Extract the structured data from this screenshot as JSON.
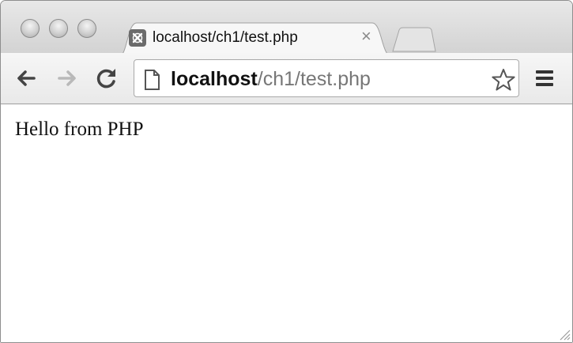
{
  "tab": {
    "title": "localhost/ch1/test.php",
    "close_glyph": "×",
    "favicon": "xampp-icon"
  },
  "omnibox": {
    "host": "localhost",
    "path": "/ch1/test.php"
  },
  "toolbar": {
    "back_icon": "back-arrow-icon",
    "forward_icon": "forward-arrow-icon",
    "reload_icon": "reload-icon",
    "bookmark_icon": "star-icon",
    "menu_icon": "hamburger-menu-icon"
  },
  "page": {
    "body_text": "Hello from PHP"
  }
}
